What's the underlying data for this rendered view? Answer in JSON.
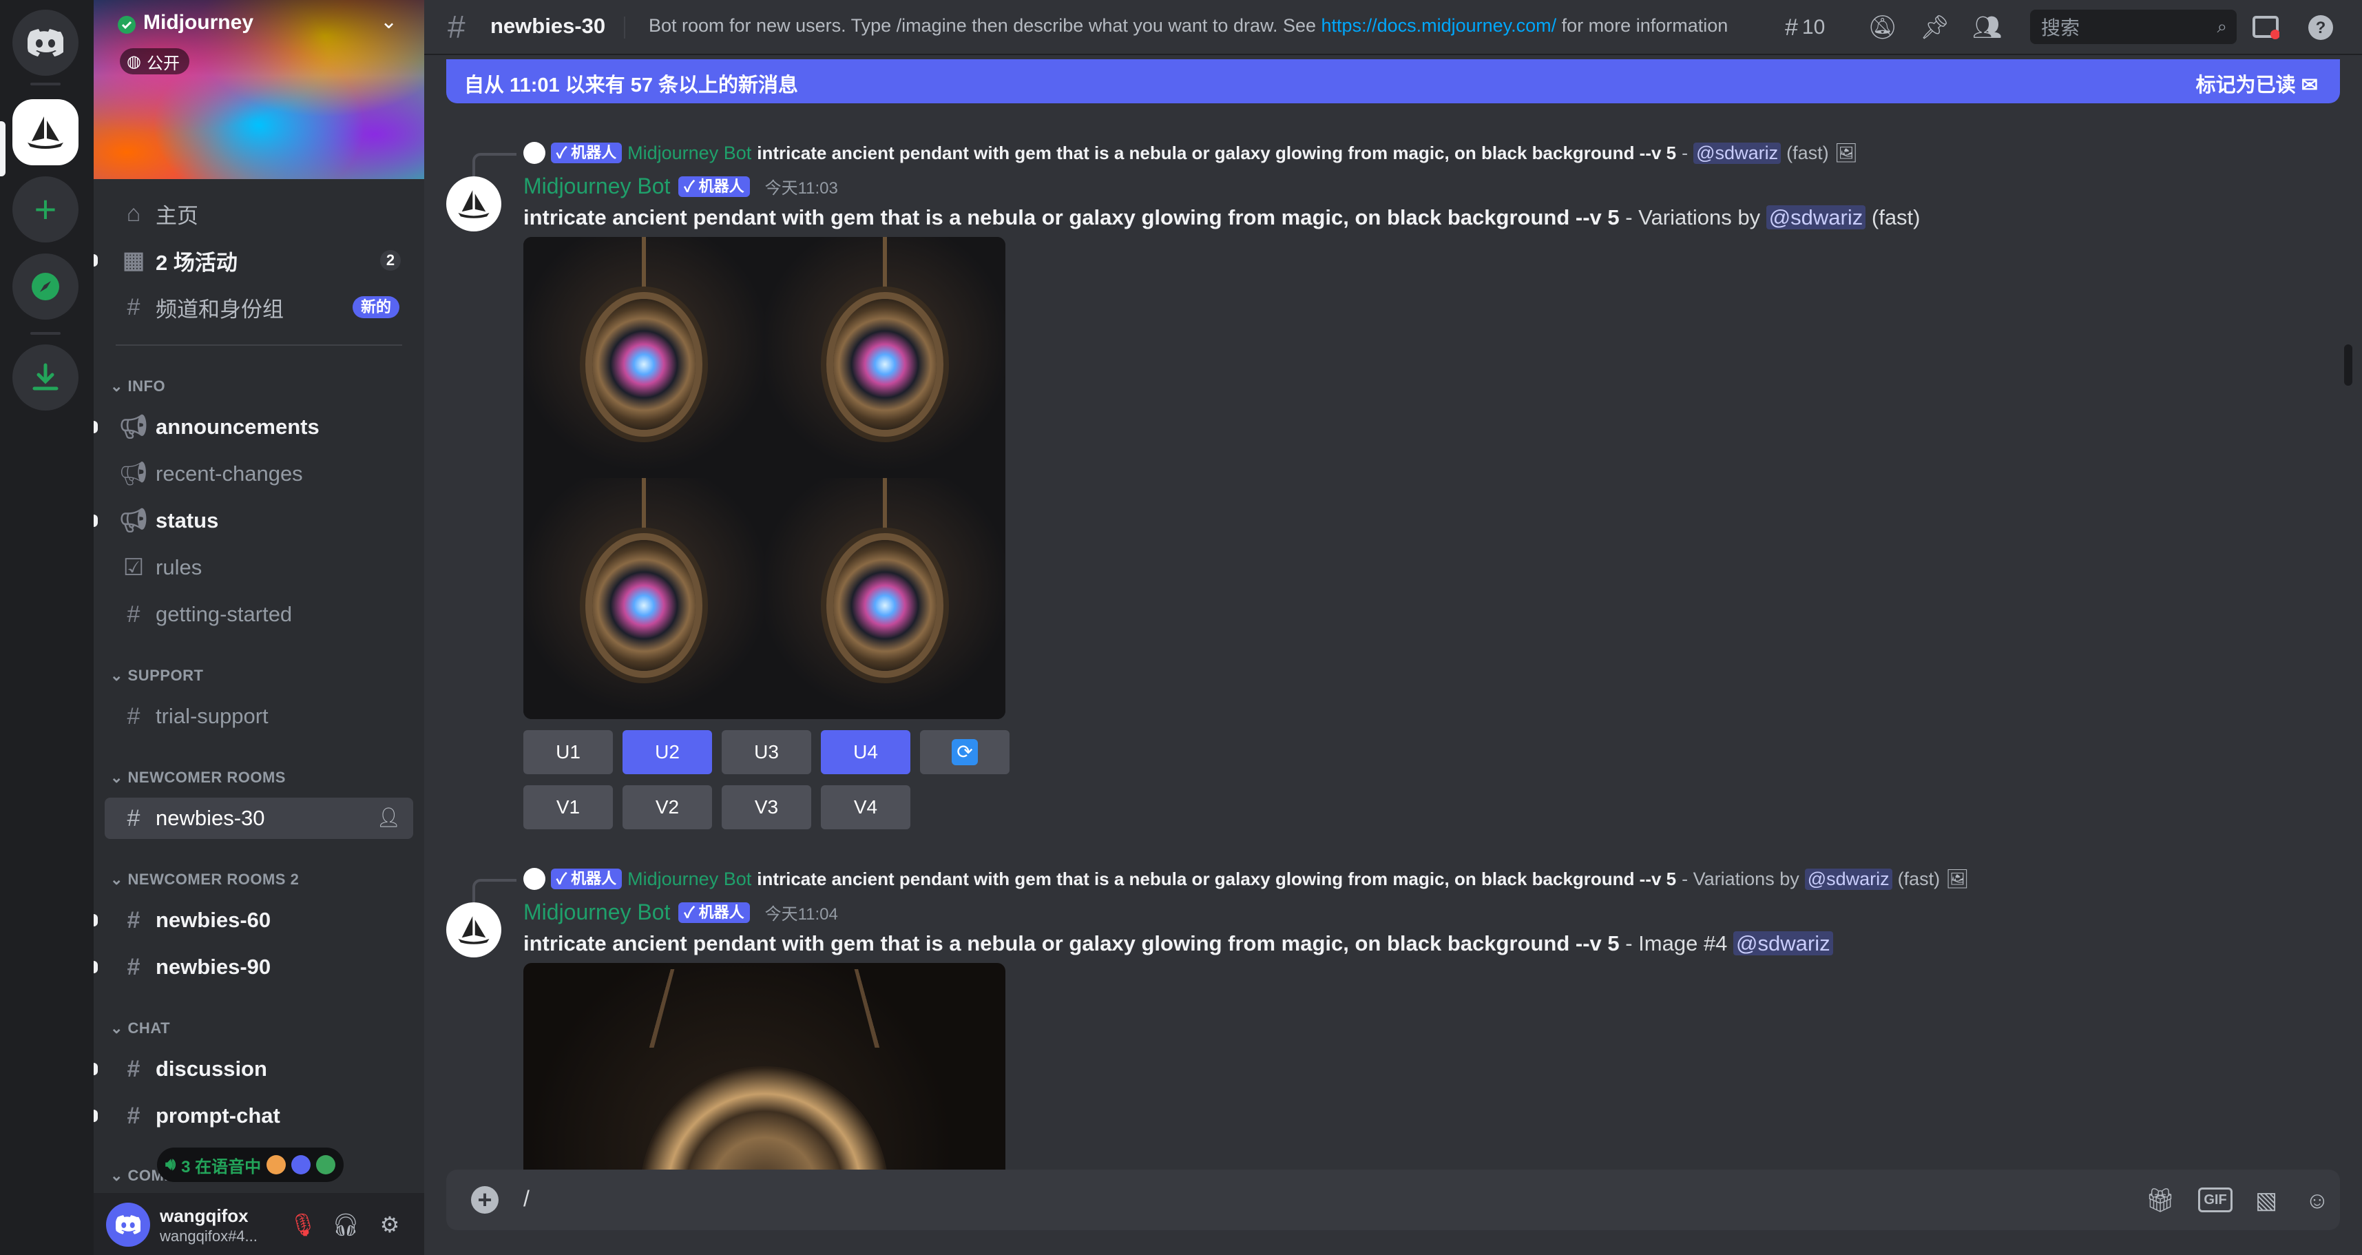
{
  "server": {
    "name": "Midjourney",
    "visibility": "公开",
    "nav": {
      "home": "主页",
      "events": "2 场活动",
      "events_count": "2",
      "channels_roles": "频道和身份组",
      "new_badge": "新的"
    },
    "categories": {
      "info": "INFO",
      "support": "SUPPORT",
      "newcomer": "NEWCOMER ROOMS",
      "newcomer2": "NEWCOMER ROOMS 2",
      "chat": "CHAT",
      "community": "COMM"
    },
    "channels": {
      "announcements": "announcements",
      "recent_changes": "recent-changes",
      "status": "status",
      "rules": "rules",
      "getting_started": "getting-started",
      "trial_support": "trial-support",
      "newbies_30": "newbies-30",
      "newbies_60": "newbies-60",
      "newbies_90": "newbies-90",
      "discussion": "discussion",
      "prompt_chat": "prompt-chat"
    },
    "voice": "3 在语音中"
  },
  "user": {
    "name": "wangqifox",
    "tag": "wangqifox#4..."
  },
  "header": {
    "channel": "newbies-30",
    "topic_before": "Bot room for new users. Type /imagine then describe what you want to draw. See ",
    "topic_link": "https://docs.midjourney.com/",
    "topic_after": " for more information",
    "thread_count": "10",
    "search_placeholder": "搜索"
  },
  "new_messages": {
    "text": "自从 11:01 以来有 57 条以上的新消息",
    "mark_read": "标记为已读"
  },
  "messages": [
    {
      "reply_tag": "✓ 机器人",
      "reply_author": "Midjourney Bot",
      "reply_prompt": "intricate ancient pendant with gem that is a nebula or galaxy glowing from magic, on black background --v 5",
      "reply_suffix": " - ",
      "reply_mention": "@sdwariz",
      "reply_speed": "(fast)",
      "author": "Midjourney Bot",
      "bot_tag": "✓ 机器人",
      "time": "今天11:03",
      "prompt": "intricate ancient pendant with gem that is a nebula or galaxy glowing from magic, on black background --v 5",
      "suffix": " - Variations by ",
      "mention": "@sdwariz",
      "speed": " (fast)",
      "buttons_row1": [
        "U1",
        "U2",
        "U3",
        "U4"
      ],
      "buttons_row2": [
        "V1",
        "V2",
        "V3",
        "V4"
      ]
    },
    {
      "reply_tag": "✓ 机器人",
      "reply_author": "Midjourney Bot",
      "reply_prompt": "intricate ancient pendant with gem that is a nebula or galaxy glowing from magic, on black background --v 5",
      "reply_suffix": " - Variations by ",
      "reply_mention": "@sdwariz",
      "reply_speed": "(fast)",
      "author": "Midjourney Bot",
      "bot_tag": "✓ 机器人",
      "time": "今天11:04",
      "prompt": "intricate ancient pendant with gem that is a nebula or galaxy glowing from magic, on black background --v 5",
      "suffix": " - Image #4 ",
      "mention": "@sdwariz"
    }
  ],
  "composer": {
    "value": "/",
    "gif": "GIF"
  },
  "colors": {
    "accent": "#5865f2",
    "bot_name": "#1fa06b",
    "link": "#00a8fc"
  }
}
